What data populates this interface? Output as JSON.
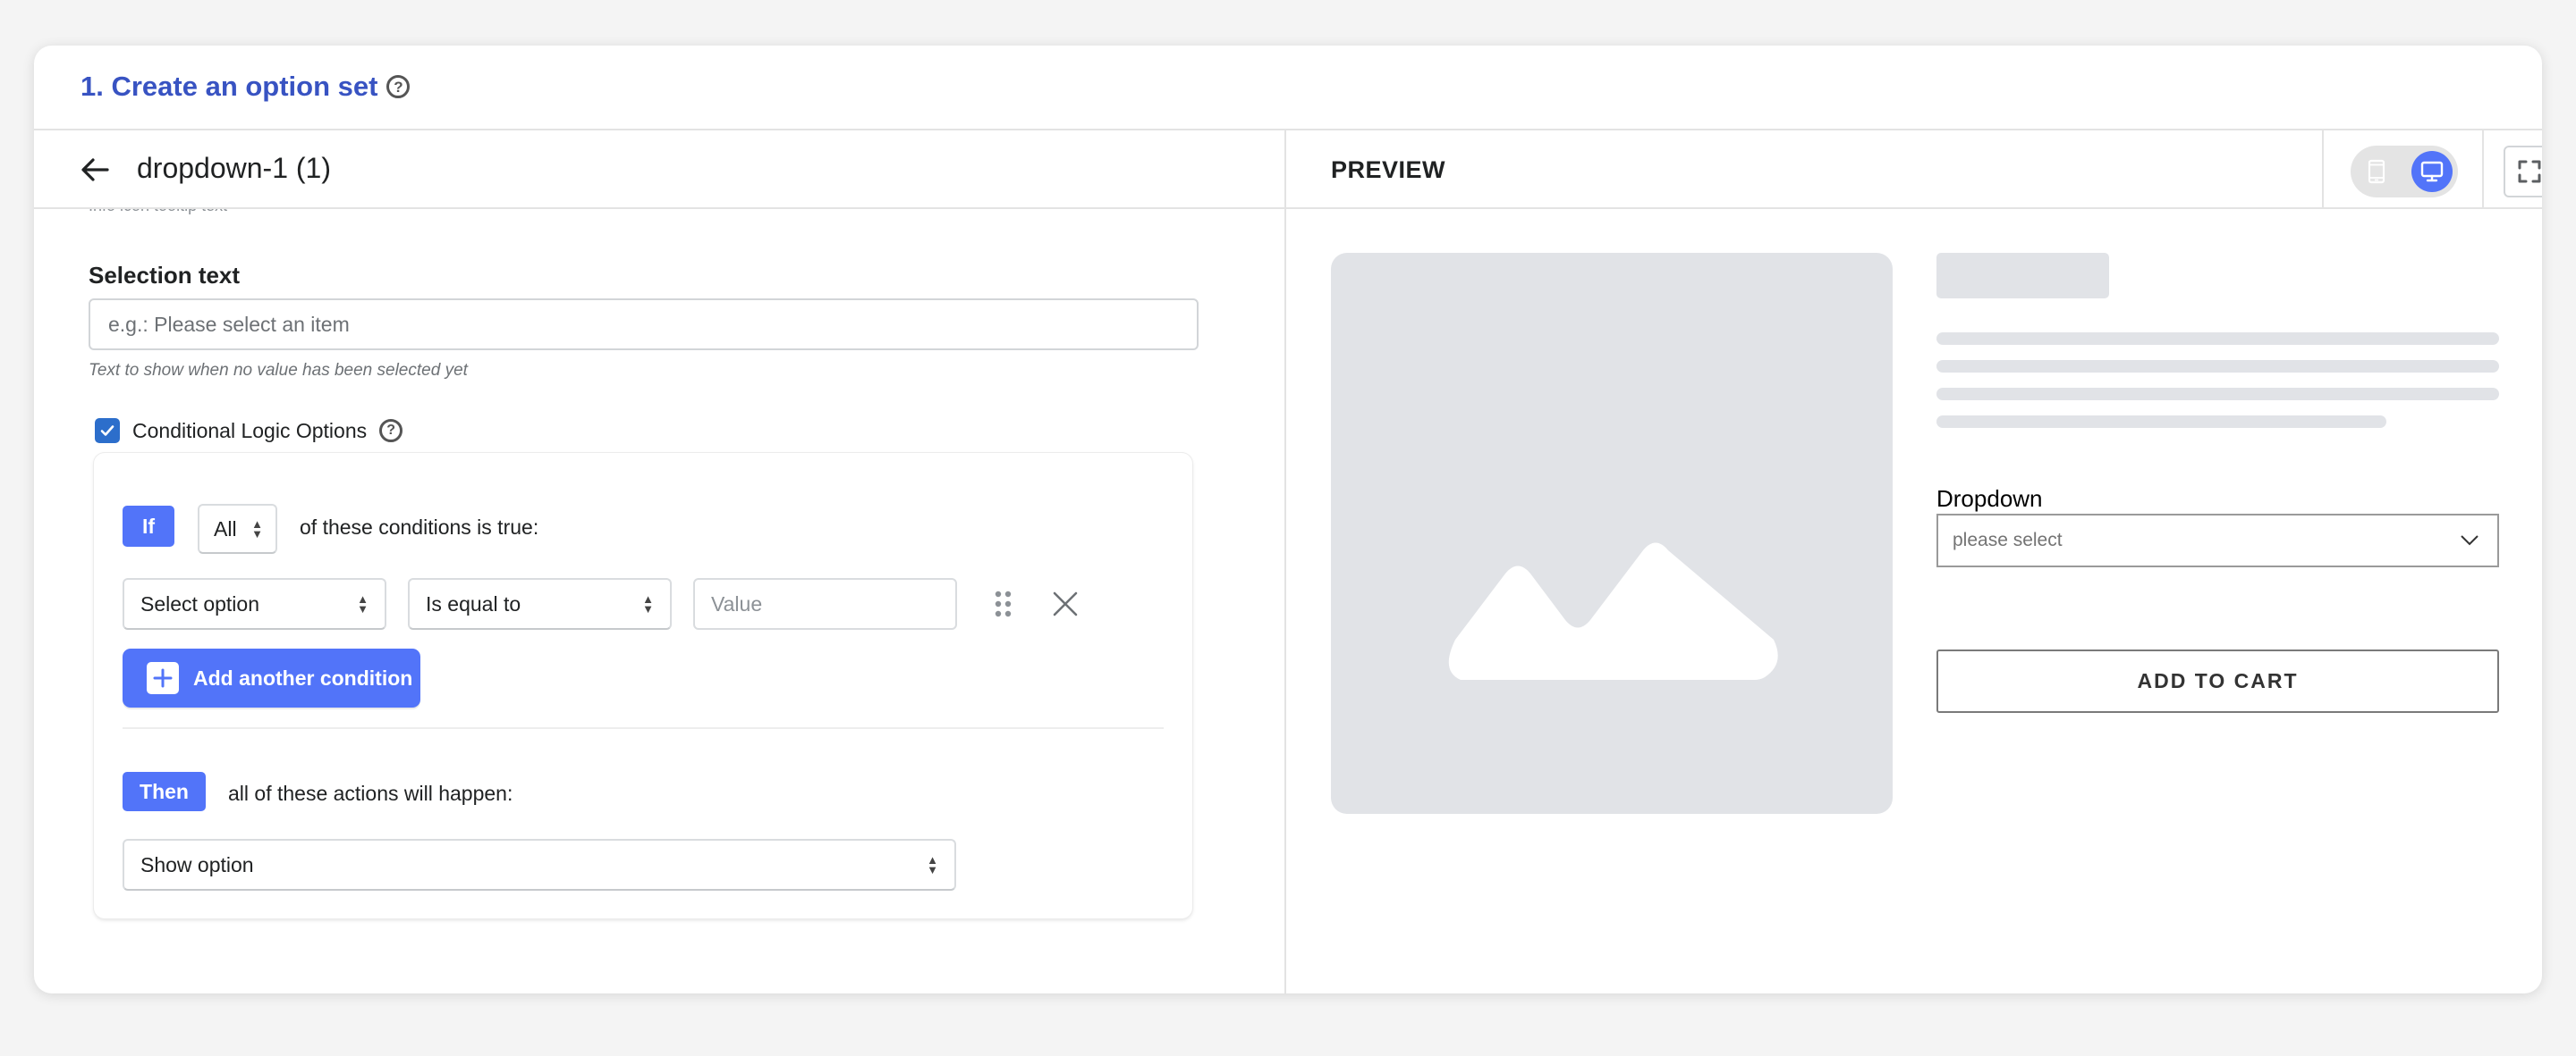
{
  "title_bar": {
    "title": "1. Create an option set",
    "help_icon": "question-circle-icon"
  },
  "editor": {
    "back_icon": "arrow-left-icon",
    "option_name": "dropdown-1 (1)",
    "clipped_helper": "Info icon tooltip text",
    "selection_text": {
      "label": "Selection text",
      "value": "",
      "placeholder": "e.g.: Please select an item",
      "helper": "Text to show when no value has been selected yet"
    },
    "conditional_logic": {
      "checked": true,
      "label": "Conditional Logic Options",
      "help_icon": "question-circle-icon",
      "if_badge": "If",
      "match_select": "All",
      "if_text": "of these conditions is true:",
      "conditions": [
        {
          "option_select": "Select option",
          "operator_select": "Is equal to",
          "value": "",
          "value_placeholder": "Value",
          "drag_icon": "drag-handle-icon",
          "remove_icon": "close-icon"
        }
      ],
      "add_condition_label": "Add another condition",
      "then_badge": "Then",
      "then_text": "all of these actions will happen:",
      "action_select": "Show option"
    }
  },
  "preview": {
    "header": "PREVIEW",
    "device_toggle": {
      "options": [
        "mobile",
        "desktop"
      ],
      "selected": "desktop"
    },
    "fullscreen_icon": "expand-icon",
    "dropdown_label": "Dropdown",
    "dropdown_placeholder": "please select",
    "add_to_cart_label": "ADD TO CART"
  },
  "colors": {
    "title": "#3853c2",
    "accent": "#5274f9",
    "checkbox": "#2c6ecb",
    "skeleton": "#e1e3e7"
  }
}
